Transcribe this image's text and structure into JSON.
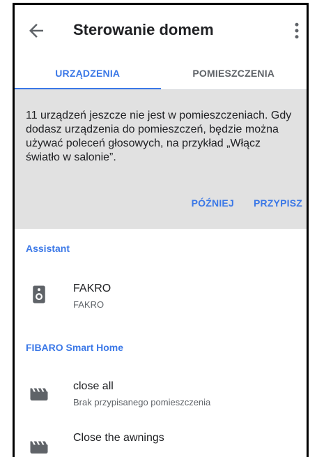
{
  "appbar": {
    "title": "Sterowanie domem",
    "back_icon": "arrow-back-icon",
    "menu_icon": "more-vert-icon"
  },
  "tabs": [
    {
      "label": "URZĄDZENIA",
      "active": true
    },
    {
      "label": "POMIESZCZENIA",
      "active": false
    }
  ],
  "banner": {
    "message": "11 urządzeń jeszcze nie jest w pomieszczeniach. Gdy dodasz urządzenia do pomieszczeń, będzie można używać poleceń głosowych, na przykład „Włącz światło w salonie”.",
    "later_label": "PÓŹNIEJ",
    "assign_label": "PRZYPISZ"
  },
  "sections": [
    {
      "header": "Assistant",
      "devices": [
        {
          "name": "FAKRO",
          "subtitle": "FAKRO",
          "icon": "speaker-icon"
        }
      ]
    },
    {
      "header": "FIBARO Smart Home",
      "devices": [
        {
          "name": "close all",
          "subtitle": "Brak przypisanego pomieszczenia",
          "icon": "awning-icon"
        },
        {
          "name": "Close the awnings",
          "subtitle": "",
          "icon": "awning-icon"
        }
      ]
    }
  ],
  "colors": {
    "accent": "#3b78e7",
    "banner_bg": "#e1e1e1",
    "text_primary": "#202124",
    "text_secondary": "#5f6368",
    "icon": "#5f6368"
  }
}
